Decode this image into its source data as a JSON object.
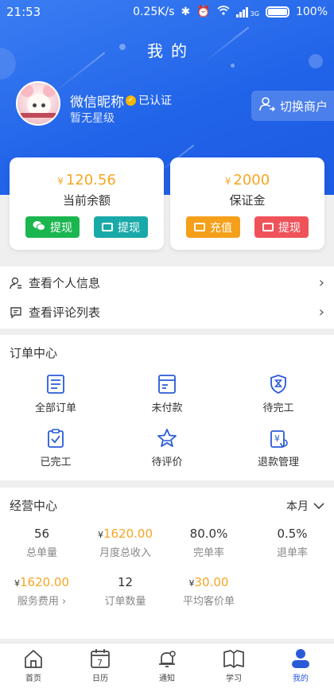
{
  "status_bar": {
    "time": "21:53",
    "speed": "0.25K/s",
    "network": "3G",
    "battery": "100%"
  },
  "header": {
    "title": "我的"
  },
  "profile": {
    "nickname": "微信昵称",
    "verified_label": "已认证",
    "level": "暂无星级",
    "switch_label": "切换商户"
  },
  "wallet": {
    "balance": {
      "currency": "¥",
      "amount": "120.56",
      "label": "当前余额",
      "btn1": "提现",
      "btn2": "提现"
    },
    "deposit": {
      "currency": "¥",
      "amount": "2000",
      "label": "保证金",
      "btn1": "充值",
      "btn2": "提现"
    }
  },
  "links": {
    "personal_info": "查看个人信息",
    "reviews": "查看评论列表"
  },
  "orders": {
    "title": "订单中心",
    "items": [
      "全部订单",
      "未付款",
      "待完工",
      "已完工",
      "待评价",
      "退款管理"
    ]
  },
  "business": {
    "title": "经营中心",
    "period": "本月",
    "stats": [
      {
        "value": "56",
        "label": "总单量"
      },
      {
        "currency": "¥",
        "value": "1620.00",
        "label": "月度总收入"
      },
      {
        "value": "80.0%",
        "label": "完单率"
      },
      {
        "value": "0.5%",
        "label": "退单率"
      },
      {
        "currency": "¥",
        "value": "1620.00",
        "label": "服务费用"
      },
      {
        "value": "12",
        "label": "订单数量"
      },
      {
        "currency": "¥",
        "value": "30.00",
        "label": "平均客价单"
      }
    ]
  },
  "tabbar": {
    "home": "首页",
    "calendar": "日历",
    "calendar_day": "7",
    "notice": "通知",
    "study": "学习",
    "mine": "我的"
  },
  "colors": {
    "primary": "#2062e8",
    "gold": "#f5a623",
    "green": "#1bb64f",
    "teal": "#1aa9a9",
    "orange": "#f5a01a",
    "red": "#f0525a"
  }
}
